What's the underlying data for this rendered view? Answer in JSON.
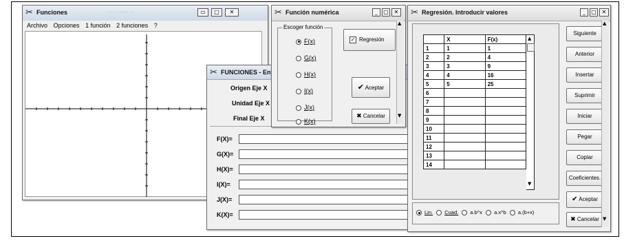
{
  "funciones": {
    "title": "Funciones",
    "title_blur": "····· ······· ··",
    "menu": [
      "Archivo",
      "Opciones",
      "1 función",
      "2 funciones",
      "?"
    ]
  },
  "entrada": {
    "title": "FUNCIONES - Entrad",
    "labels": [
      "Origen Eje X",
      "Unidad Eje X",
      "Final Eje X"
    ],
    "fields": [
      "F(X)=",
      "G(X)=",
      "H(X)=",
      "I(X)=",
      "J(X)=",
      "K(X)="
    ]
  },
  "numerica": {
    "title": "Función numérica",
    "group_label": "Escoger función",
    "options": [
      "F(x)",
      "G(x)",
      "H(x)",
      "I(x)",
      "J(x)",
      "K(x)"
    ],
    "selected": "F(x)",
    "regresion_label": "Regresión",
    "regresion_checked": true,
    "accept_label": "Aceptar",
    "cancel_label": "Cancelar"
  },
  "regresion": {
    "title": "Regresión. Introducir valores",
    "headers": [
      "X",
      "F(x)"
    ],
    "rows": [
      {
        "n": "1",
        "x": "1",
        "f": "1"
      },
      {
        "n": "2",
        "x": "2",
        "f": "4"
      },
      {
        "n": "3",
        "x": "3",
        "f": "9"
      },
      {
        "n": "4",
        "x": "4",
        "f": "16"
      },
      {
        "n": "5",
        "x": "5",
        "f": "25"
      },
      {
        "n": "6",
        "x": "",
        "f": ""
      },
      {
        "n": "7",
        "x": "",
        "f": ""
      },
      {
        "n": "8",
        "x": "",
        "f": ""
      },
      {
        "n": "9",
        "x": "",
        "f": ""
      },
      {
        "n": "10",
        "x": "",
        "f": ""
      },
      {
        "n": "11",
        "x": "",
        "f": ""
      },
      {
        "n": "12",
        "x": "",
        "f": ""
      },
      {
        "n": "13",
        "x": "",
        "f": ""
      },
      {
        "n": "14",
        "x": "",
        "f": ""
      }
    ],
    "buttons": [
      "Siguiente",
      "Anterior",
      "Insertar",
      "Suprimir",
      "Iniciar",
      "Pegar",
      "Copiar",
      "Coeficientes.",
      "Aceptar",
      "Cancelar"
    ],
    "fit_options": [
      "Lin.",
      "Cuad.",
      "a.b^x",
      "a.x^b",
      "a.(b+x)"
    ],
    "fit_selected": "Lin."
  },
  "icons": {
    "app": "scissors-app-icon",
    "accept": "checkmark-icon",
    "cancel": "x-cross-icon"
  }
}
